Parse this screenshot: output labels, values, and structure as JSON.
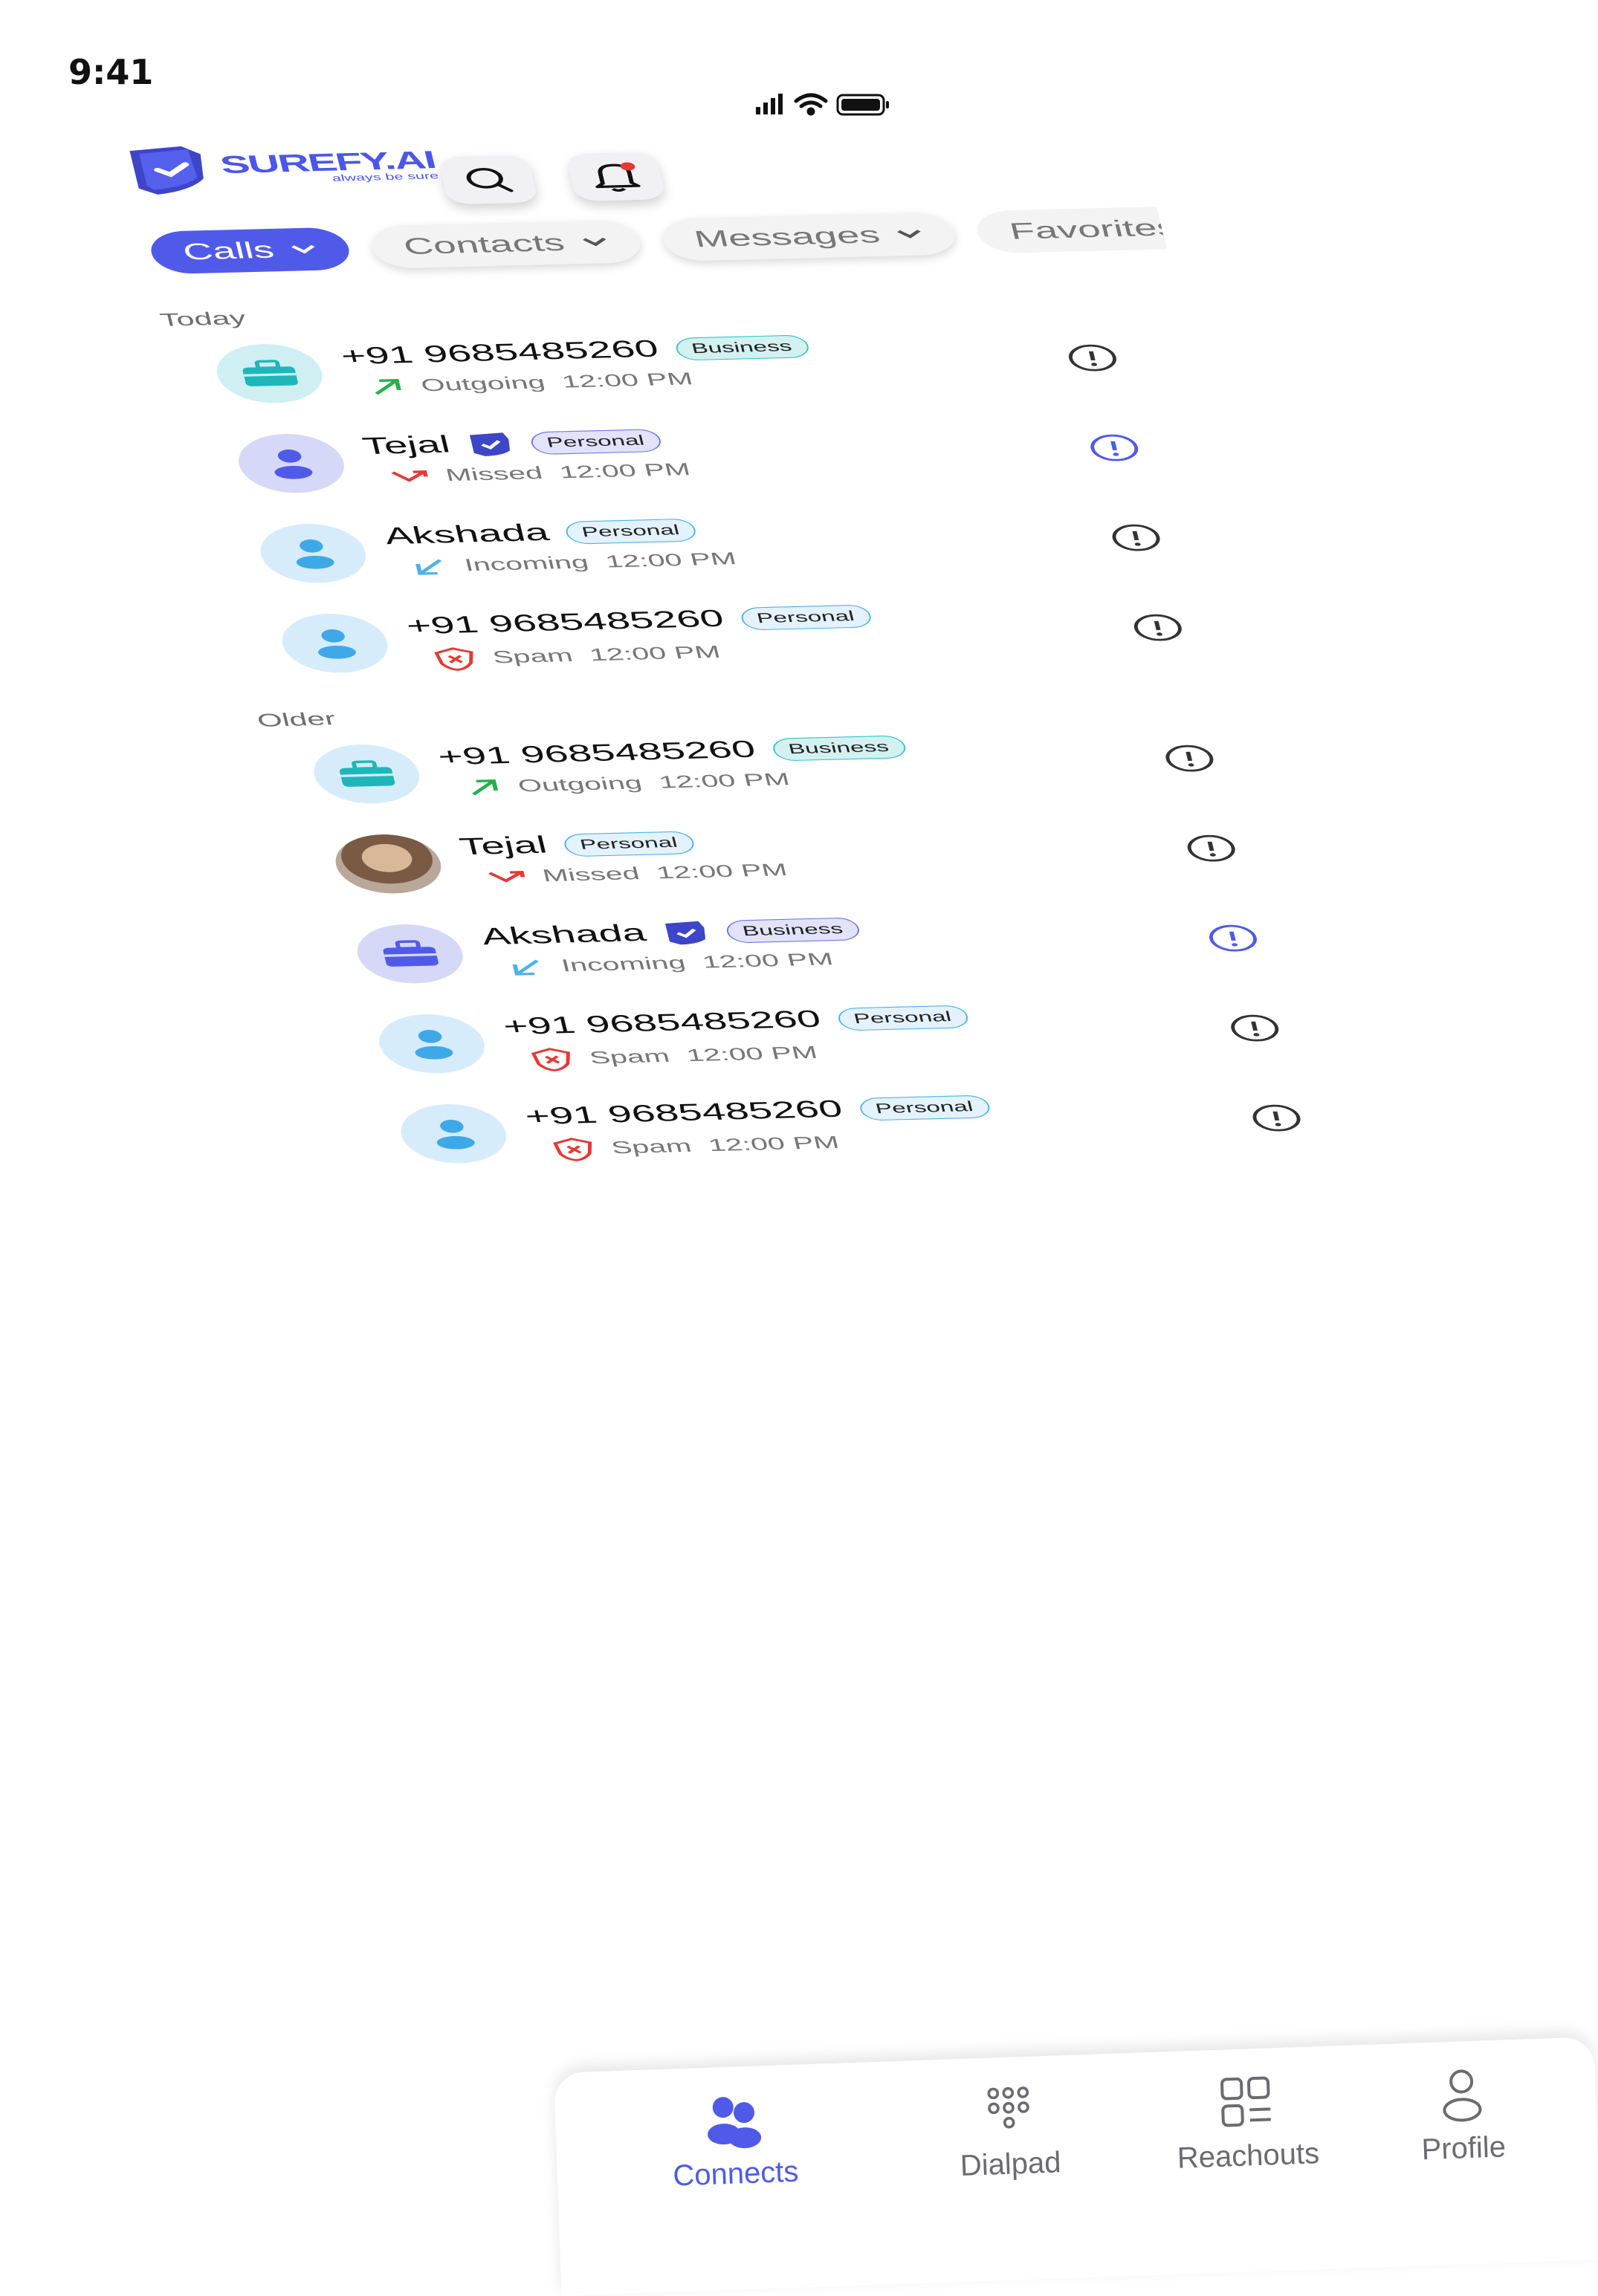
{
  "status_bar": {
    "time": "9:41"
  },
  "brand": {
    "name": "SUREFY.AI",
    "tagline": "always be sure"
  },
  "tabs": [
    {
      "label": "Calls",
      "active": true
    },
    {
      "label": "Contacts",
      "active": false
    },
    {
      "label": "Messages",
      "active": false
    },
    {
      "label": "Favorites",
      "active": false
    }
  ],
  "sections": {
    "today": "Today",
    "older": "Older"
  },
  "calls": [
    {
      "name": "+91 9685485260",
      "tag": "Business",
      "type": "Outgoing",
      "time": "12:00 PM",
      "verified": false
    },
    {
      "name": "Tejal",
      "tag": "Personal",
      "type": "Missed",
      "time": "12:00 PM",
      "verified": true
    },
    {
      "name": "Akshada",
      "tag": "Personal",
      "type": "Incoming",
      "time": "12:00 PM",
      "verified": false
    },
    {
      "name": "+91 9685485260",
      "tag": "Personal",
      "type": "Spam",
      "time": "12:00 PM",
      "verified": false
    },
    {
      "name": "+91 9685485260",
      "tag": "Business",
      "type": "Outgoing",
      "time": "12:00 PM",
      "verified": false
    },
    {
      "name": "Tejal",
      "tag": "Personal",
      "type": "Missed",
      "time": "12:00 PM",
      "verified": false
    },
    {
      "name": "Akshada",
      "tag": "Business",
      "type": "Incoming",
      "time": "12:00 PM",
      "verified": true
    },
    {
      "name": "+91 9685485260",
      "tag": "Personal",
      "type": "Spam",
      "time": "12:00 PM",
      "verified": false
    },
    {
      "name": "+91 9685485260",
      "tag": "Personal",
      "type": "Spam",
      "time": "12:00 PM",
      "verified": false
    }
  ],
  "nav": [
    {
      "label": "Connects",
      "active": true
    },
    {
      "label": "Dialpad",
      "active": false
    },
    {
      "label": "Reachouts",
      "active": false
    },
    {
      "label": "Profile",
      "active": false
    }
  ],
  "colors": {
    "accent": "#4F5BE8",
    "business": "#33C5C5",
    "outgoing": "#22B14C",
    "missed": "#E53935",
    "incoming": "#4DB2EA",
    "spam": "#E53935"
  }
}
